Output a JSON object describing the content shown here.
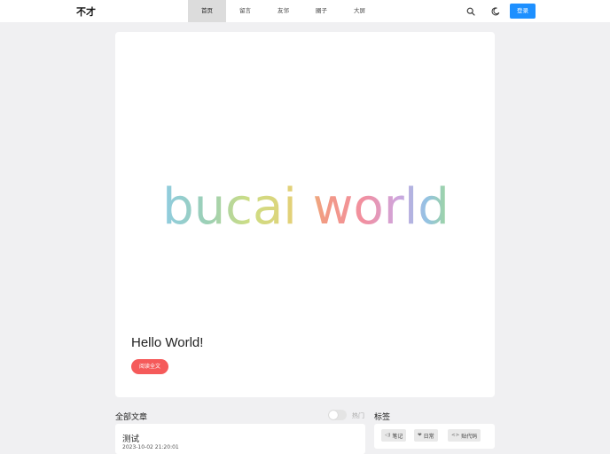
{
  "header": {
    "logo": "不才",
    "nav": [
      {
        "label": "首页",
        "active": true
      },
      {
        "label": "留言",
        "active": false
      },
      {
        "label": "友邻",
        "active": false
      },
      {
        "label": "圈子",
        "active": false
      },
      {
        "label": "大屏",
        "active": false
      }
    ],
    "tools": {
      "search_icon": "search-icon",
      "theme_icon": "moon-icon"
    },
    "login_label": "登录"
  },
  "hero": {
    "image_text": "bucai world",
    "title": "Hello World!",
    "read_more_label": "阅读全文",
    "colors": {
      "button": "#f55a5a"
    }
  },
  "articles": {
    "section_title": "全部文章",
    "toggle_label": "热门",
    "toggle_on": false,
    "items": [
      {
        "title": "测试",
        "date": "2023-10-02 21:20:01"
      }
    ]
  },
  "tags": {
    "section_title": "标签",
    "items": [
      {
        "label": "笔记",
        "icon": "speaker-icon"
      },
      {
        "label": "日常",
        "icon": "heart-icon"
      },
      {
        "label": "贴代码",
        "icon": "code-icon"
      }
    ]
  },
  "colors": {
    "accent": "#1e90ff",
    "background": "#f0f0f2"
  }
}
